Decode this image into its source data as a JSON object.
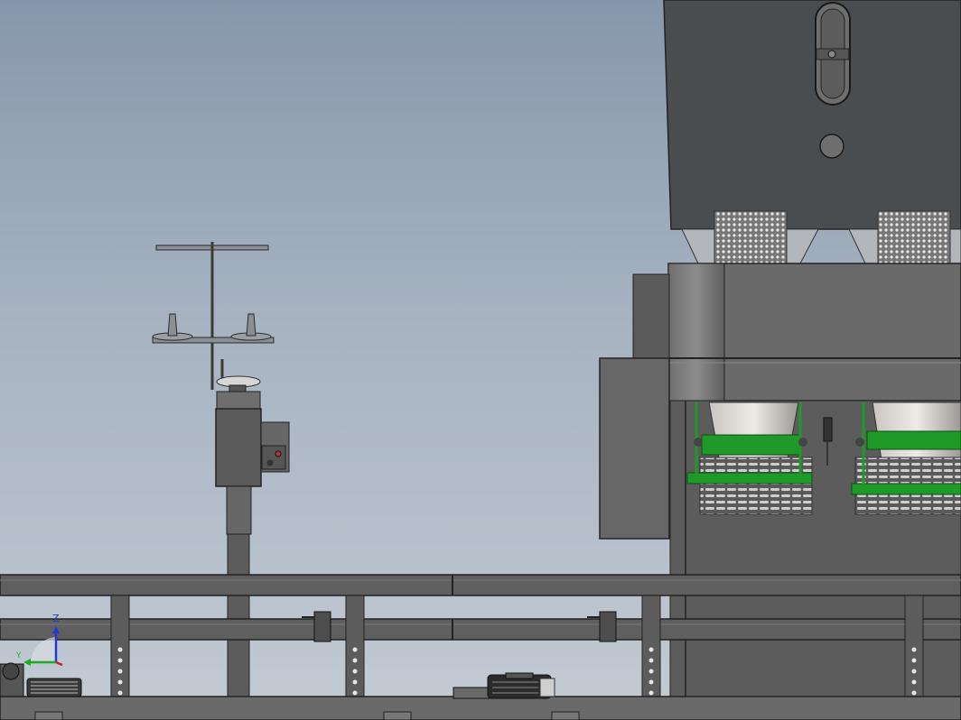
{
  "viewport": {
    "background_top": "#8797ab",
    "background_bottom": "#c3cbd4"
  },
  "model": {
    "machine_body_color": "#4a4d50",
    "frame_color": "#5b5b5b",
    "bracket_color": "#1f9a28"
  },
  "triad": {
    "z_label": "Z",
    "y_label": "Y",
    "z_color": "#1f3ad6",
    "y_color": "#1faa20",
    "x_color": "#d21f1f"
  }
}
